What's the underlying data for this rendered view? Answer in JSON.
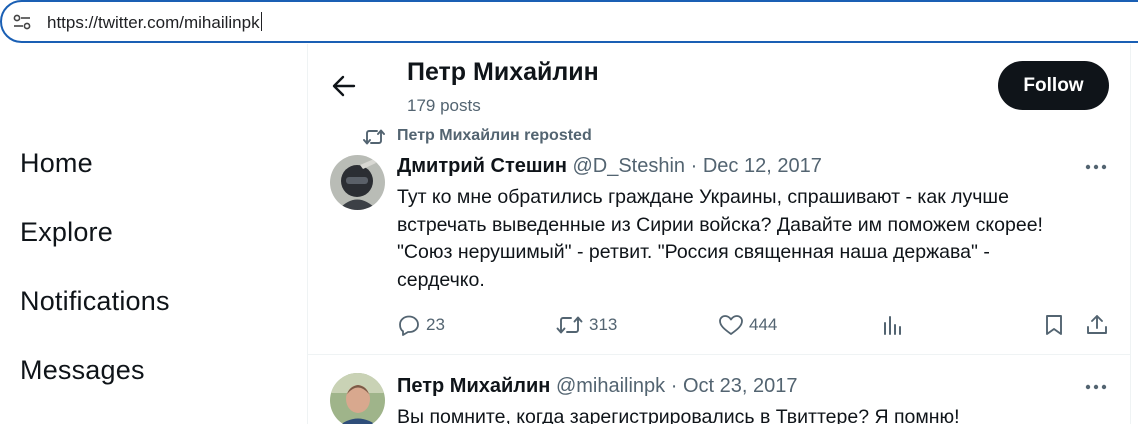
{
  "browser": {
    "url": "https://twitter.com/mihailinpk"
  },
  "nav": {
    "items": [
      "Home",
      "Explore",
      "Notifications",
      "Messages"
    ]
  },
  "header": {
    "name": "Петр Михайлин",
    "post_count": "179 posts",
    "follow_label": "Follow"
  },
  "repost": {
    "text": "Петр Михайлин reposted"
  },
  "tweets": [
    {
      "name": "Дмитрий Стешин",
      "handle": "@D_Steshin",
      "sep": "·",
      "date": "Dec 12, 2017",
      "lines": [
        "Тут ко мне обратились граждане Украины, спрашивают - как лучше",
        "встречать выведенные из Сирии войска? Давайте им поможем скорее!",
        "\"Союз нерушимый\" - ретвит. \"Россия священная наша держава\" -",
        "сердечко."
      ],
      "replies": "23",
      "retweets": "313",
      "likes": "444"
    },
    {
      "name": "Петр Михайлин",
      "handle": "@mihailinpk",
      "sep": "·",
      "date": "Oct 23, 2017",
      "lines": [
        "Вы помните, когда зарегистрировались в Твиттере? Я помню!"
      ]
    }
  ],
  "icons": {
    "site_info": "site-info-icon",
    "back": "arrow-left-icon",
    "repost": "repost-icon",
    "more": "more-icon",
    "reply": "reply-icon",
    "retweet": "retweet-icon",
    "like": "like-icon",
    "views": "views-icon",
    "bookmark": "bookmark-icon",
    "share": "share-icon"
  },
  "colors": {
    "address_border": "#1a5fb4",
    "text": "#0f1419",
    "secondary": "#536471",
    "follow_bg": "#0f1419"
  }
}
